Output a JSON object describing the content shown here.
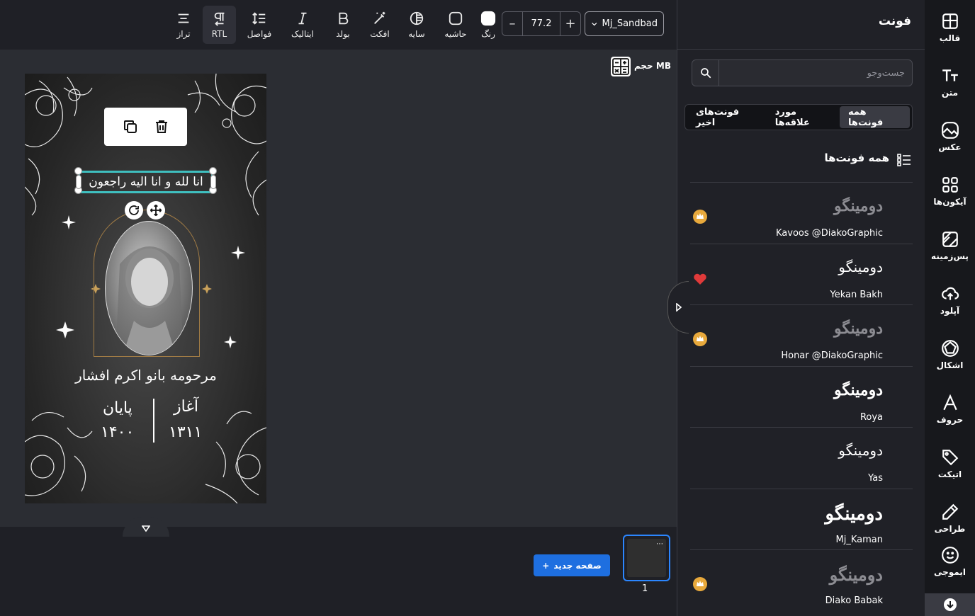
{
  "toolbar": {
    "font_name": "Mj_Sandbad",
    "font_size": "77.2",
    "minus": "–",
    "plus": "+",
    "tools": [
      {
        "label": "رنگ",
        "icon": "color-swatch-icon"
      },
      {
        "label": "حاشیه",
        "icon": "border-icon"
      },
      {
        "label": "سایه",
        "icon": "shadow-icon"
      },
      {
        "label": "افکت",
        "icon": "magic-wand-icon"
      },
      {
        "label": "بولد",
        "icon": "bold-icon"
      },
      {
        "label": "ایتالیک",
        "icon": "italic-icon"
      },
      {
        "label": "فواصل",
        "icon": "spacing-icon"
      },
      {
        "label": "RTL",
        "icon": "rtl-icon"
      },
      {
        "label": "تراز",
        "icon": "align-icon"
      }
    ]
  },
  "canvas": {
    "size_label": "حجم MB",
    "selected_text": "انا لله و انا الیه راجعون",
    "deceased_name": "مرحومه بانو اکرم افشار",
    "start_label": "آغاز",
    "start_year": "۱۳۱۱",
    "end_label": "پایان",
    "end_year": "۱۴۰۰"
  },
  "pages": {
    "new_page_label": "صفحه جدید",
    "current_page": "1",
    "thumb_menu": "⋯"
  },
  "panel": {
    "title": "فونت",
    "search_placeholder": "جست‌وجو",
    "tabs": [
      "همه فونت‌ها",
      "مورد علاقه‌ها",
      "فونت‌های اخیر"
    ],
    "active_tab": "همه فونت‌ها",
    "section_title": "همه فونت‌ها",
    "fonts": [
      {
        "preview": "دومینگو",
        "name": "Kavoos @DiakoGraphic",
        "badge": "premium",
        "dim": true
      },
      {
        "preview": "دومینگو",
        "name": "Yekan Bakh",
        "badge": "favorite",
        "dim": false
      },
      {
        "preview": "دومینگو",
        "name": "Honar @DiakoGraphic",
        "badge": "premium",
        "dim": true
      },
      {
        "preview": "دومینگو",
        "name": "Roya",
        "badge": "",
        "dim": false
      },
      {
        "preview": "دومینگو",
        "name": "Yas",
        "badge": "",
        "dim": false
      },
      {
        "preview": "دومینگو",
        "name": "Mj_Kaman",
        "badge": "",
        "dim": false
      },
      {
        "preview": "دومینگو",
        "name": "Diako Babak",
        "badge": "premium",
        "dim": true
      }
    ]
  },
  "sidebar": {
    "items": [
      {
        "label": "قالب",
        "icon": "template-icon"
      },
      {
        "label": "متن",
        "icon": "text-icon"
      },
      {
        "label": "عکس",
        "icon": "photo-icon"
      },
      {
        "label": "آیکون‌ها",
        "icon": "icons-grid-icon"
      },
      {
        "label": "پس‌زمینه",
        "icon": "background-icon"
      },
      {
        "label": "آپلود",
        "icon": "upload-icon"
      },
      {
        "label": "اشکال",
        "icon": "shapes-icon"
      },
      {
        "label": "حروف",
        "icon": "letters-icon"
      },
      {
        "label": "اتیکت",
        "icon": "tag-icon"
      },
      {
        "label": "طراحی",
        "icon": "pen-icon"
      },
      {
        "label": "ایموجی",
        "icon": "emoji-icon"
      }
    ]
  },
  "colors": {
    "accent": "#1e6fe0",
    "selection": "#3fbfbf",
    "premium": "#e8a93c",
    "favorite": "#e03a3a"
  }
}
